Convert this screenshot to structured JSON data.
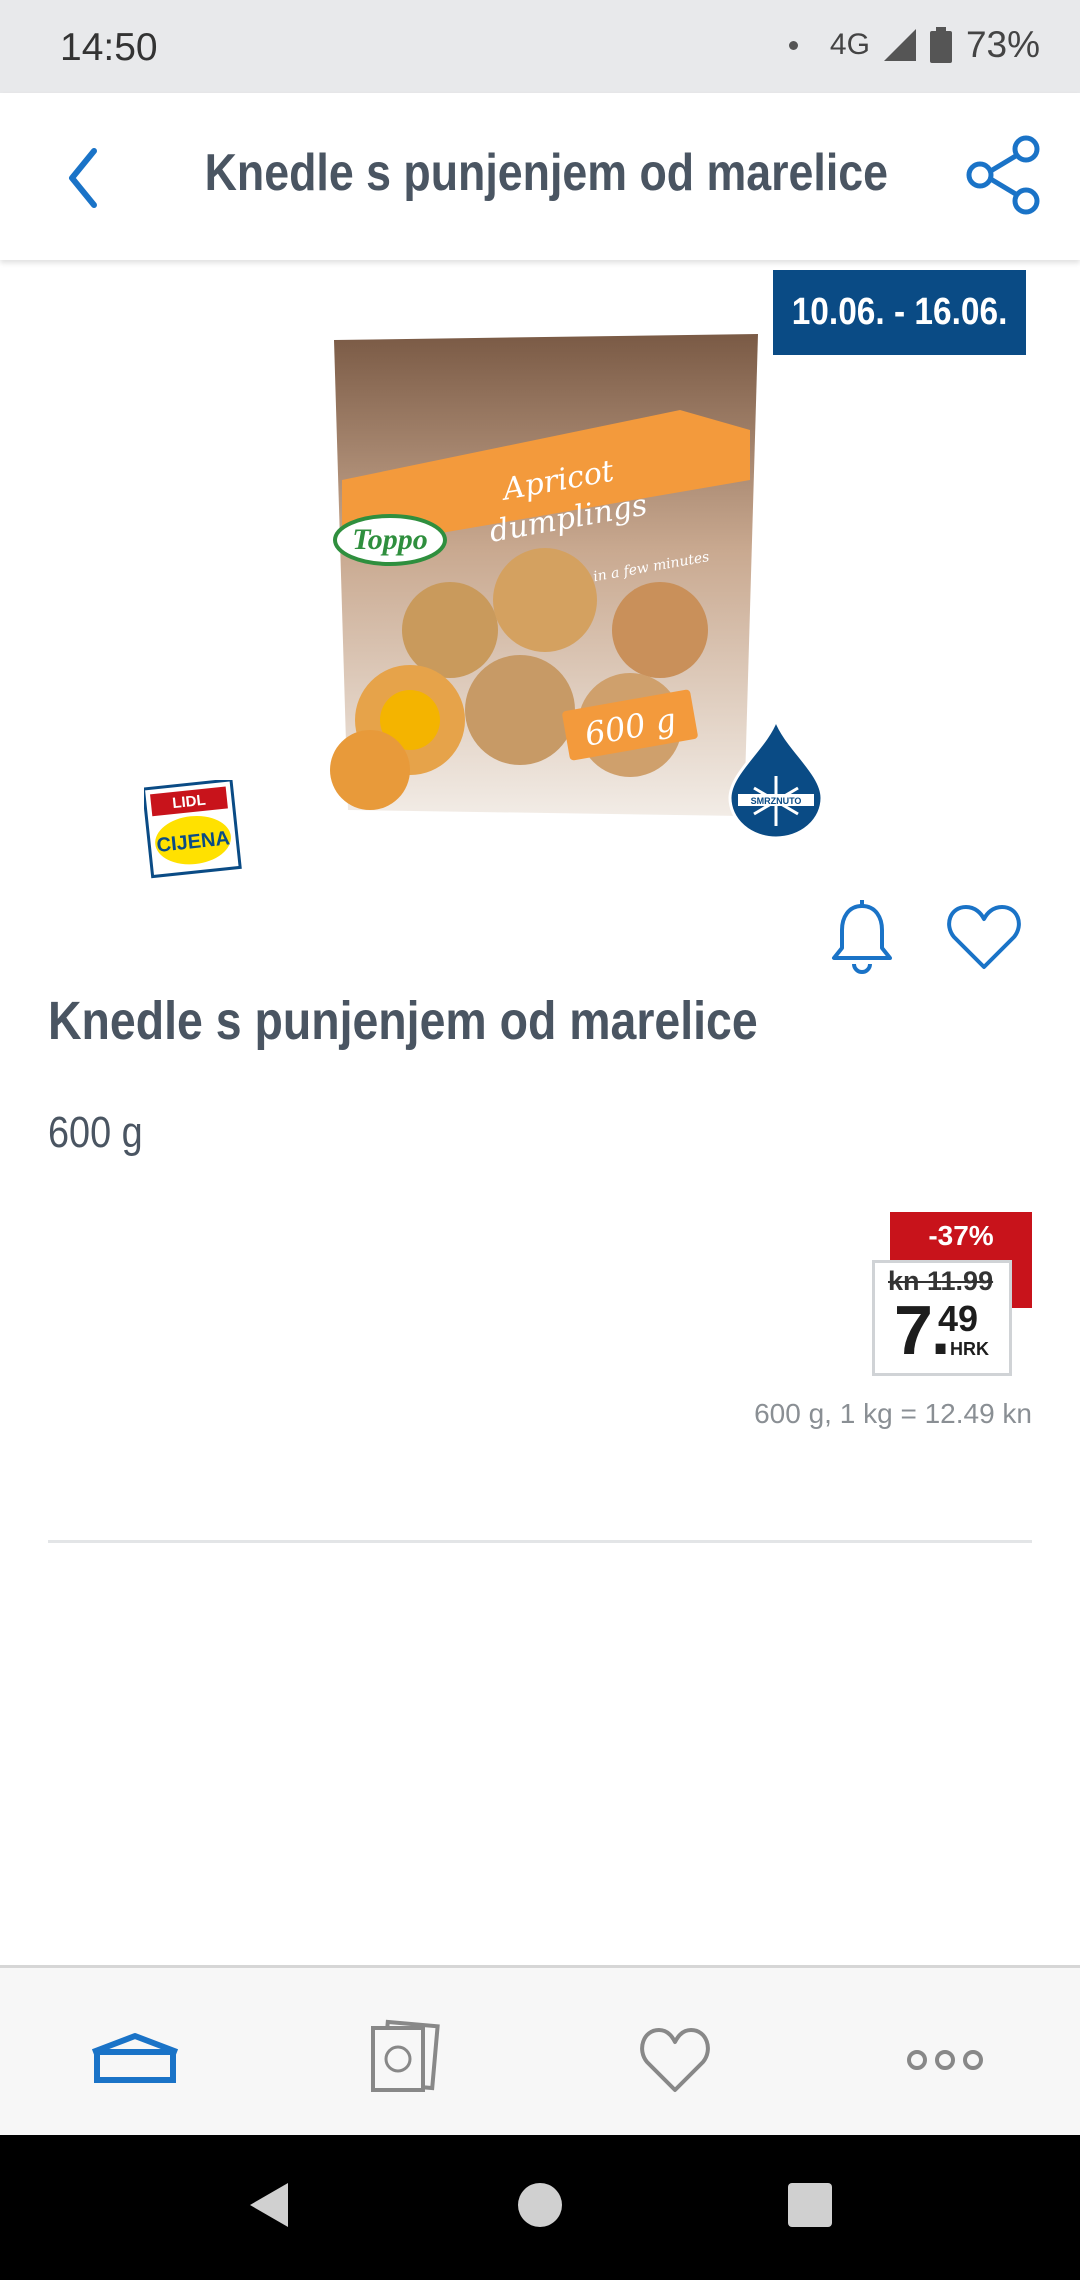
{
  "status_bar": {
    "time": "14:50",
    "network": "4G",
    "battery": "73%"
  },
  "app_bar": {
    "title": "Knedle s punjenjem od marelice",
    "back_icon": "chevron-left-icon",
    "share_icon": "share-icon"
  },
  "product": {
    "date_range": "10.06. - 16.06.",
    "title": "Knedle s punjenjem od marelice",
    "weight": "600 g",
    "image": {
      "brand": "Toppo",
      "name_line1": "Apricot",
      "name_line2": "dumplings",
      "tagline": "ready in a few minutes",
      "weight": "600 g",
      "frozen_label": "SMRZNUTO",
      "badge_top": "LIDL",
      "badge_bottom": "CIJENA"
    }
  },
  "price": {
    "discount": "-37%",
    "old_price": "kn 11.99",
    "main": "7.",
    "cents": "49",
    "currency": "HRK",
    "unit_price": "600 g, 1 kg = 12.49 kn"
  },
  "colors": {
    "lidl_blue": "#0a4b85",
    "accent_blue": "#1a73c7",
    "discount_red": "#c8131b",
    "text": "#4a5562"
  },
  "bottom_nav": [
    "home-icon",
    "leaflet-icon",
    "heart-icon",
    "more-icon"
  ],
  "system_nav": [
    "back-icon",
    "home-icon",
    "recents-icon"
  ]
}
